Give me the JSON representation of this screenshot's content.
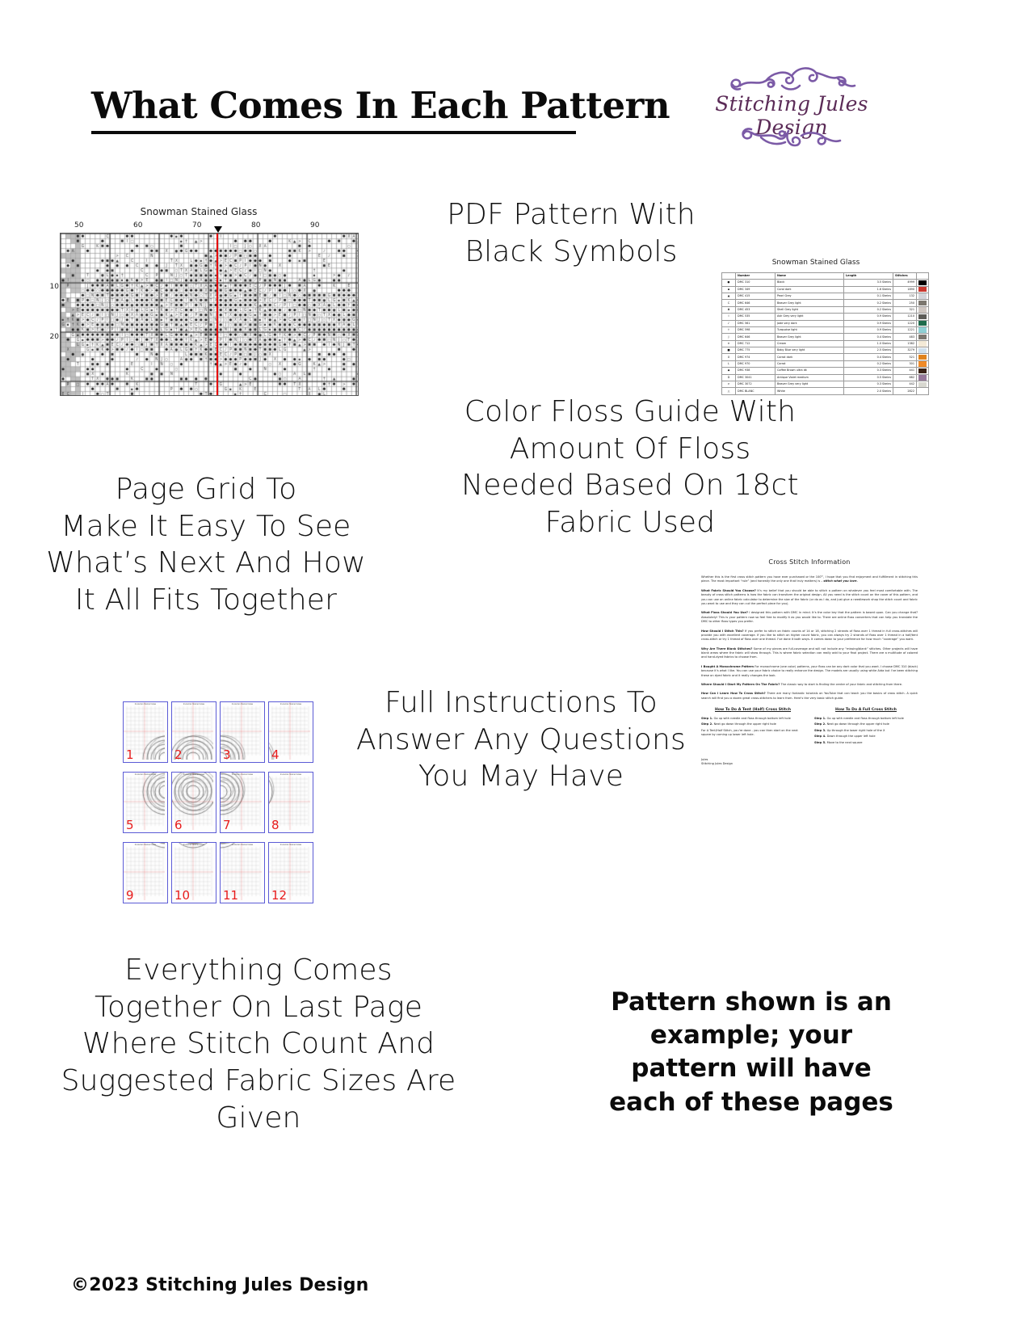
{
  "header": {
    "title": "What Comes In Each Pattern",
    "logo": {
      "brand": "Stitching Jules Design",
      "flourish_top": "flourish-ornament-top",
      "flourish_bottom": "flourish-ornament-bottom",
      "color": "#5b2b57",
      "accent_color": "#7b5aa6"
    }
  },
  "headings": {
    "pdf_pattern": "PDF Pattern With\nBlack Symbols",
    "page_grid": "Page Grid To\nMake It Easy To See\nWhat’s Next And How\nIt All Fits Together",
    "floss_guide": "Color Floss Guide With\nAmount Of Floss\nNeeded Based On 18ct\nFabric Used",
    "instructions": "Full Instructions To\nAnswer Any Questions\nYou May Have",
    "last_page": "Everything Comes\nTogether On Last Page\nWhere Stitch Count And\nSuggested Fabric Sizes Are\nGiven"
  },
  "callout": "Pattern shown is an example; your pattern will have each of these pages",
  "copyright": "©2023 Stitching Jules Design",
  "chart": {
    "title": "Snowman Stained Glass",
    "column_labels": [
      "50",
      "60",
      "70",
      "80",
      "90"
    ],
    "row_labels": [
      "10",
      "20"
    ],
    "center_marker_column": "80",
    "center_line_color": "#e50000"
  },
  "floss_table": {
    "title": "Snowman Stained Glass",
    "columns": [
      "",
      "Number",
      "Name",
      "Length",
      "Stitches",
      ""
    ],
    "rows": [
      {
        "symbol": "●",
        "number": "DMC  310",
        "name": "Black",
        "length": "3.5 Skeins",
        "stitches": "4999",
        "color": "#000000"
      },
      {
        "symbol": "▪",
        "number": "DMC  349",
        "name": "Coral dark",
        "length": "1.6 Skeins",
        "stitches": "1890",
        "color": "#c9392f"
      },
      {
        "symbol": "▲",
        "number": "DMC  415",
        "name": "Pearl Grey",
        "length": "0.1 Skeins",
        "stitches": "132",
        "color": "#d3d5da"
      },
      {
        "symbol": "C",
        "number": "DMC  646",
        "name": "Beaver Grey light",
        "length": "0.2 Skeins",
        "stitches": "250",
        "color": "#7c776f"
      },
      {
        "symbol": "♣",
        "number": "DMC  453",
        "name": "Shell Grey light",
        "length": "0.2 Skeins",
        "stitches": "321",
        "color": "#cfc7c2"
      },
      {
        "symbol": "I",
        "number": "DMC  535",
        "name": "Ash Grey very light",
        "length": "0.9 Skeins",
        "stitches": "1210",
        "color": "#5c5c58"
      },
      {
        "symbol": "♪",
        "number": "DMC  561",
        "name": "Jade very dark",
        "length": "0.9 Skeins",
        "stitches": "1220",
        "color": "#1f6b4c"
      },
      {
        "symbol": "†",
        "number": "DMC  598",
        "name": "Turquoise light",
        "length": "0.9 Skeins",
        "stitches": "1221",
        "color": "#8fd0d4"
      },
      {
        "symbol": "J",
        "number": "DMC  646",
        "name": "Beaver Grey light",
        "length": "0.4 Skeins",
        "stitches": "483",
        "color": "#7c776f"
      },
      {
        "symbol": "✕",
        "number": "DMC  712",
        "name": "Cream",
        "length": "1.0 Skeins",
        "stitches": "1382",
        "color": "#f4ead7"
      },
      {
        "symbol": "■",
        "number": "DMC  775",
        "name": "Baby Blue very light",
        "length": "2.5 Skeins",
        "stitches": "3279",
        "color": "#cfe0ee"
      },
      {
        "symbol": "X",
        "number": "DMC  974",
        "name": "Carrot dark",
        "length": "0.4 Skeins",
        "stitches": "521",
        "color": "#e0821c"
      },
      {
        "symbol": "L",
        "number": "DMC  970",
        "name": "Carrot",
        "length": "0.2 Skeins",
        "stitches": "301",
        "color": "#f08a28"
      },
      {
        "symbol": "◆",
        "number": "DMC  938",
        "name": "Coffee Brown ultra dk",
        "length": "0.3 Skeins",
        "stitches": "441",
        "color": "#3a2317"
      },
      {
        "symbol": "D",
        "number": "DMC  3041",
        "name": "Antique Violet medium",
        "length": "0.5 Skeins",
        "stitches": "682",
        "color": "#96789a"
      },
      {
        "symbol": ">",
        "number": "DMC  3072",
        "name": "Beaver Grey very light",
        "length": "0.3 Skeins",
        "stitches": "442",
        "color": "#d8d8d0"
      },
      {
        "symbol": "△",
        "number": "DMC  BLANC",
        "name": "White",
        "length": "2.0 Skeins",
        "stitches": "2822",
        "color": "#ffffff"
      }
    ]
  },
  "page_grid": {
    "thumbnail_title": "Snowman Stained Glass",
    "numbers": [
      "1",
      "2",
      "3",
      "4",
      "5",
      "6",
      "7",
      "8",
      "9",
      "10",
      "11",
      "12"
    ],
    "border_color": "#5b5bd6",
    "number_color": "#e81c1c"
  },
  "instructions_doc": {
    "title": "Cross Stitch Information",
    "intro": "Whether this is the first cross stitch pattern you have ever purchased or the 100ᵗʰ, I hope that you find enjoyment and fulfillment in stitching this piece. The most important “rule” (and honestly the only one that truly matters) is – stitch what you love.",
    "intro_emphasis": "stitch what you love.",
    "sections": [
      {
        "q": "What Fabric Should You Choose?",
        "a": " It’s my belief that you should be able to stitch a pattern on whatever you feel most comfortable with. The beauty of cross stitch patterns is how the fabric can transform the original design. All you need is the stitch count on the cover of this pattern, and you can use an online fabric calculator to determine the size of the fabric (or do as I do, and just give a needlework shop the stitch count and fabric you want to use and they can cut the perfect piece for you)."
      },
      {
        "q": "What Floss Should You Use?",
        "a": " I designed this pattern with DMC in mind. It’s the color key that the pattern is based upon. Can you change that? Absolutely! This is your pattern now so feel free to modify it as you would like to. There are online floss converters that can help you translate the DMC to other floss types you prefer."
      },
      {
        "q": "How Should I Stitch This?",
        "a": " If you prefer to stitch on fabric counts of 14 or 18, stitching 2 strands of floss over 1 thread in full cross-stitches will provide you with excellent coverage. If you like to stitch on higher count fabric, you can always try 2 strands of floss over 1 thread in a half/tent cross-stitch or try 1 thread of floss over one thread. I’ve done it both ways. It comes down to your preference for how much “coverage” you want."
      },
      {
        "q": "Why Are There Blank Stitches?",
        "a": " Some of my pieces are full-coverage and will not include any “missing/blank” stitches. Other projects will have blank areas where the fabric will show through. This is where fabric selection can really add to your final project. There are a multitude of colored and hand-dyed fabrics to choose from."
      },
      {
        "q": "I Bought A Monochrome Pattern",
        "a": " For monochrome (one color) patterns, your floss can be any dark color that you want. I choose DMC 310 (black) because it’s what I like. You can use your fabric choice to really enhance the design. The models are usually using white Aida but I’ve been stitching these on dyed fabric and it really changes the look."
      },
      {
        "q": "Where Should I Start My Pattern On The Fabric?",
        "a": " The classic way to start is finding the center of your fabric and stitching from there."
      },
      {
        "q": "How Can I Learn How To Cross Stitch?",
        "a": " There are many fantastic tutorials on YouTube that can teach you the basics of cross stitch. A quick search will find you a dozen great cross-stitchers to learn from. Here’s the very basic stitch guide."
      }
    ],
    "guides": [
      {
        "title": "How To Do A Tent (Half) Cross Stitch",
        "steps": [
          "Step 1. Go up with needle and floss through bottom left hole",
          "Step 2. Next go down through the upper right hole",
          "For A Tent/Half Stitch, you’re done - you can then start on the next square by coming up lower left hole."
        ]
      },
      {
        "title": "How To Do A Full Cross Stitch",
        "steps": [
          "Step 1. Go up with needle and floss through bottom left hole",
          "Step 2. Next go down through the upper right hole",
          "Step 3. Up through the lower right hole of the X",
          "Step 4. Down through the upper left hole",
          "Step 5. Move to the next square"
        ]
      }
    ],
    "signature": "Jules\nStitching Jules Design"
  }
}
